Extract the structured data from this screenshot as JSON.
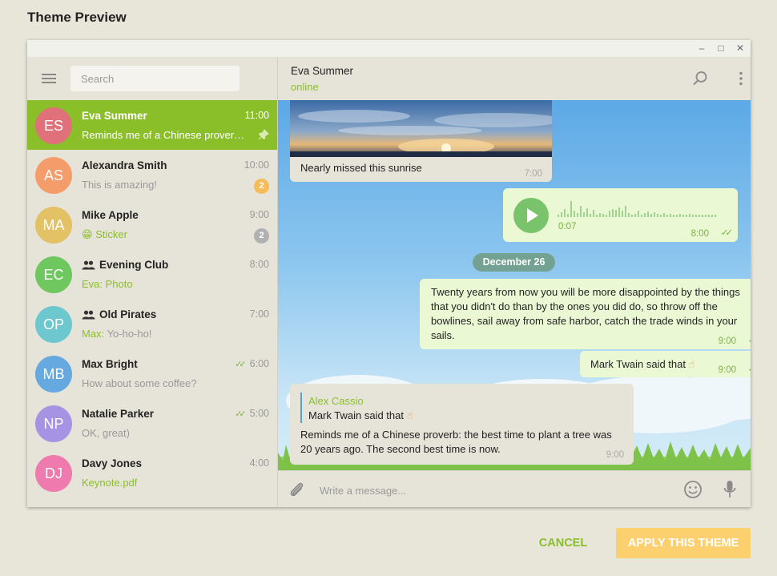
{
  "dialog": {
    "title": "Theme Preview",
    "cancel_label": "CANCEL",
    "apply_label": "APPLY THIS THEME"
  },
  "window_controls": {
    "minimize": "–",
    "maximize": "□",
    "close": "✕"
  },
  "search": {
    "placeholder": "Search"
  },
  "chats": [
    {
      "initials": "ES",
      "avatar_color": "#e0707a",
      "name": "Eva Summer",
      "time": "11:00",
      "preview": "Reminds me of a Chinese proverb: the best time to plant a tree",
      "active": true,
      "pinned": true
    },
    {
      "initials": "AS",
      "avatar_color": "#f59d6a",
      "name": "Alexandra Smith",
      "time": "10:00",
      "preview": "This is amazing!",
      "badge": "2",
      "badge_color": "#f7bc57"
    },
    {
      "initials": "MA",
      "avatar_color": "#e3c165",
      "name": "Mike Apple",
      "time": "9:00",
      "preview_emoji": "😁",
      "preview": "Sticker",
      "preview_green": true,
      "badge": "2",
      "badge_color": "#b1b1b1"
    },
    {
      "initials": "EC",
      "avatar_color": "#6fc85f",
      "name": "Evening Club",
      "group": true,
      "time": "8:00",
      "preview": "Eva: Photo",
      "preview_green": true
    },
    {
      "initials": "OP",
      "avatar_color": "#6cc7cf",
      "name": "Old Pirates",
      "group": true,
      "time": "7:00",
      "preview_sender": "Max:",
      "preview": "Yo-ho-ho!"
    },
    {
      "initials": "MB",
      "avatar_color": "#65a9e0",
      "name": "Max Bright",
      "time": "6:00",
      "read": true,
      "preview": "How about some coffee?"
    },
    {
      "initials": "NP",
      "avatar_color": "#a793e4",
      "name": "Natalie Parker",
      "time": "5:00",
      "read": true,
      "preview": "OK, great)"
    },
    {
      "initials": "DJ",
      "avatar_color": "#ee7aae",
      "name": "Davy Jones",
      "time": "4:00",
      "preview": "Keynote.pdf",
      "preview_green": true
    }
  ],
  "peer": {
    "name": "Eva Summer",
    "status": "online"
  },
  "messages": {
    "photo_caption": "Nearly missed this sunrise",
    "photo_time": "7:00",
    "voice_duration": "0:07",
    "voice_time": "8:00",
    "date_separator": "December 26",
    "quote_text": "Twenty years from now you will be more disappointed by the things that you didn't do than by the ones you did do, so throw off the bowlines, sail away from safe harbor, catch the trade winds in your sails.",
    "quote_time": "9:00",
    "twain_text": "Mark Twain said that",
    "twain_emoji": "☝",
    "twain_time": "9:00",
    "reply_author": "Alex Cassio",
    "reply_quote": "Mark Twain said that",
    "reply_text": "Reminds me of a Chinese proverb: the best time to plant a tree was 20 years ago. The second best time is now.",
    "reply_time": "9:00"
  },
  "composer": {
    "placeholder": "Write a message..."
  },
  "colors": {
    "accent": "#8bbf2a",
    "apply_button": "#fdd06f"
  }
}
